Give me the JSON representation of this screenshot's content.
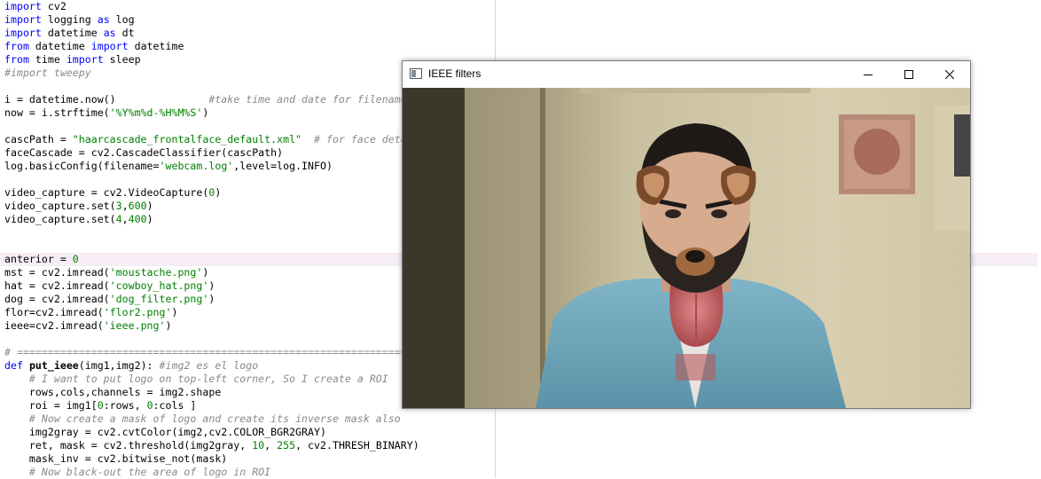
{
  "editor": {
    "lines": [
      [
        {
          "t": "import",
          "c": "kw"
        },
        {
          "t": " cv2"
        }
      ],
      [
        {
          "t": "import",
          "c": "kw"
        },
        {
          "t": " logging "
        },
        {
          "t": "as",
          "c": "kw"
        },
        {
          "t": " log"
        }
      ],
      [
        {
          "t": "import",
          "c": "kw"
        },
        {
          "t": " datetime "
        },
        {
          "t": "as",
          "c": "kw"
        },
        {
          "t": " dt"
        }
      ],
      [
        {
          "t": "from",
          "c": "kw"
        },
        {
          "t": " datetime "
        },
        {
          "t": "import",
          "c": "kw"
        },
        {
          "t": " datetime"
        }
      ],
      [
        {
          "t": "from",
          "c": "kw"
        },
        {
          "t": " time "
        },
        {
          "t": "import",
          "c": "kw"
        },
        {
          "t": " sleep"
        }
      ],
      [
        {
          "t": "#import tweepy",
          "c": "cm"
        }
      ],
      [
        {
          "t": ""
        }
      ],
      [
        {
          "t": "i = datetime.now()               "
        },
        {
          "t": "#take time and date for filename",
          "c": "cm"
        }
      ],
      [
        {
          "t": "now = i.strftime("
        },
        {
          "t": "'%Y%m%d-%H%M%S'",
          "c": "str"
        },
        {
          "t": ")"
        }
      ],
      [
        {
          "t": ""
        }
      ],
      [
        {
          "t": "cascPath = "
        },
        {
          "t": "\"haarcascade_frontalface_default.xml\"",
          "c": "str"
        },
        {
          "t": "  "
        },
        {
          "t": "# for face detection",
          "c": "cm"
        }
      ],
      [
        {
          "t": "faceCascade = cv2.CascadeClassifier(cascPath)"
        }
      ],
      [
        {
          "t": "log.basicConfig(filename="
        },
        {
          "t": "'webcam.log'",
          "c": "str"
        },
        {
          "t": ",level=log.INFO)"
        }
      ],
      [
        {
          "t": ""
        }
      ],
      [
        {
          "t": "video_capture = cv2.VideoCapture("
        },
        {
          "t": "0",
          "c": "num"
        },
        {
          "t": ")"
        }
      ],
      [
        {
          "t": "video_capture.set("
        },
        {
          "t": "3",
          "c": "num"
        },
        {
          "t": ","
        },
        {
          "t": "600",
          "c": "num"
        },
        {
          "t": ")"
        }
      ],
      [
        {
          "t": "video_capture.set("
        },
        {
          "t": "4",
          "c": "num"
        },
        {
          "t": ","
        },
        {
          "t": "400",
          "c": "num"
        },
        {
          "t": ")"
        }
      ],
      [
        {
          "t": ""
        }
      ],
      [
        {
          "t": ""
        }
      ],
      [
        {
          "t": "anterior = "
        },
        {
          "t": "0",
          "c": "num"
        }
      ],
      [
        {
          "t": "mst = cv2.imread("
        },
        {
          "t": "'moustache.png'",
          "c": "str"
        },
        {
          "t": ")"
        }
      ],
      [
        {
          "t": "hat = cv2.imread("
        },
        {
          "t": "'cowboy_hat.png'",
          "c": "str"
        },
        {
          "t": ")"
        }
      ],
      [
        {
          "t": "dog = cv2.imread("
        },
        {
          "t": "'dog_filter.png'",
          "c": "str"
        },
        {
          "t": ")"
        }
      ],
      [
        {
          "t": "flor=cv2.imread("
        },
        {
          "t": "'flor2.png'",
          "c": "str"
        },
        {
          "t": ")"
        }
      ],
      [
        {
          "t": "ieee=cv2.imread("
        },
        {
          "t": "'ieee.png'",
          "c": "str"
        },
        {
          "t": ")"
        }
      ],
      [
        {
          "t": ""
        }
      ],
      [
        {
          "t": "# ==================================================================",
          "c": "cm"
        }
      ],
      [
        {
          "t": "def",
          "c": "kw"
        },
        {
          "t": " "
        },
        {
          "t": "put_ieee",
          "c": "fn"
        },
        {
          "t": "(img1,img2): "
        },
        {
          "t": "#img2 es el logo",
          "c": "cm"
        }
      ],
      [
        {
          "t": "    "
        },
        {
          "t": "# I want to put logo on top-left corner, So I create a ROI",
          "c": "cm"
        }
      ],
      [
        {
          "t": "    rows,cols,channels = img2.shape"
        }
      ],
      [
        {
          "t": "    roi = img1["
        },
        {
          "t": "0",
          "c": "num"
        },
        {
          "t": ":rows, "
        },
        {
          "t": "0",
          "c": "num"
        },
        {
          "t": ":cols ]"
        }
      ],
      [
        {
          "t": "    "
        },
        {
          "t": "# Now create a mask of logo and create its inverse mask also",
          "c": "cm"
        }
      ],
      [
        {
          "t": "    img2gray = cv2.cvtColor(img2,cv2.COLOR_BGR2GRAY)"
        }
      ],
      [
        {
          "t": "    ret, mask = cv2.threshold(img2gray, "
        },
        {
          "t": "10",
          "c": "num"
        },
        {
          "t": ", "
        },
        {
          "t": "255",
          "c": "num"
        },
        {
          "t": ", cv2.THRESH_BINARY)"
        }
      ],
      [
        {
          "t": "    mask_inv = cv2.bitwise_not(mask)"
        }
      ],
      [
        {
          "t": "    "
        },
        {
          "t": "# Now black-out the area of logo in ROI",
          "c": "cm"
        }
      ]
    ]
  },
  "window": {
    "title": "IEEE filters",
    "icons": {
      "app": "window-app-icon",
      "minimize": "minimize-icon",
      "maximize": "maximize-icon",
      "close": "close-icon"
    }
  }
}
